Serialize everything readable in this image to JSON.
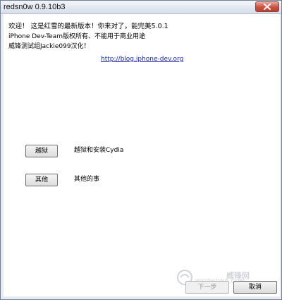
{
  "window": {
    "title": "redsn0w 0.9.10b3"
  },
  "intro": {
    "line1": "欢迎！ 这是红雪的最新版本！你来对了，能完美5.0.1",
    "line2": "iPhone Dev-Team版权所有、不能用于商业用途",
    "line3": "威锋测试组Jackie099汉化！",
    "link": "http://blog.iphone-dev.org"
  },
  "actions": [
    {
      "button": "越狱",
      "description": "越狱和安装Cydia"
    },
    {
      "button": "其他",
      "description": "其他的事"
    }
  ],
  "watermark": {
    "brand": "威锋网",
    "site": "WEIPHONE.COM"
  },
  "footer": {
    "back": "下一步",
    "cancel": "取消"
  },
  "colors": {
    "link": "#1a2aa8",
    "close_button": "#c9513f"
  }
}
